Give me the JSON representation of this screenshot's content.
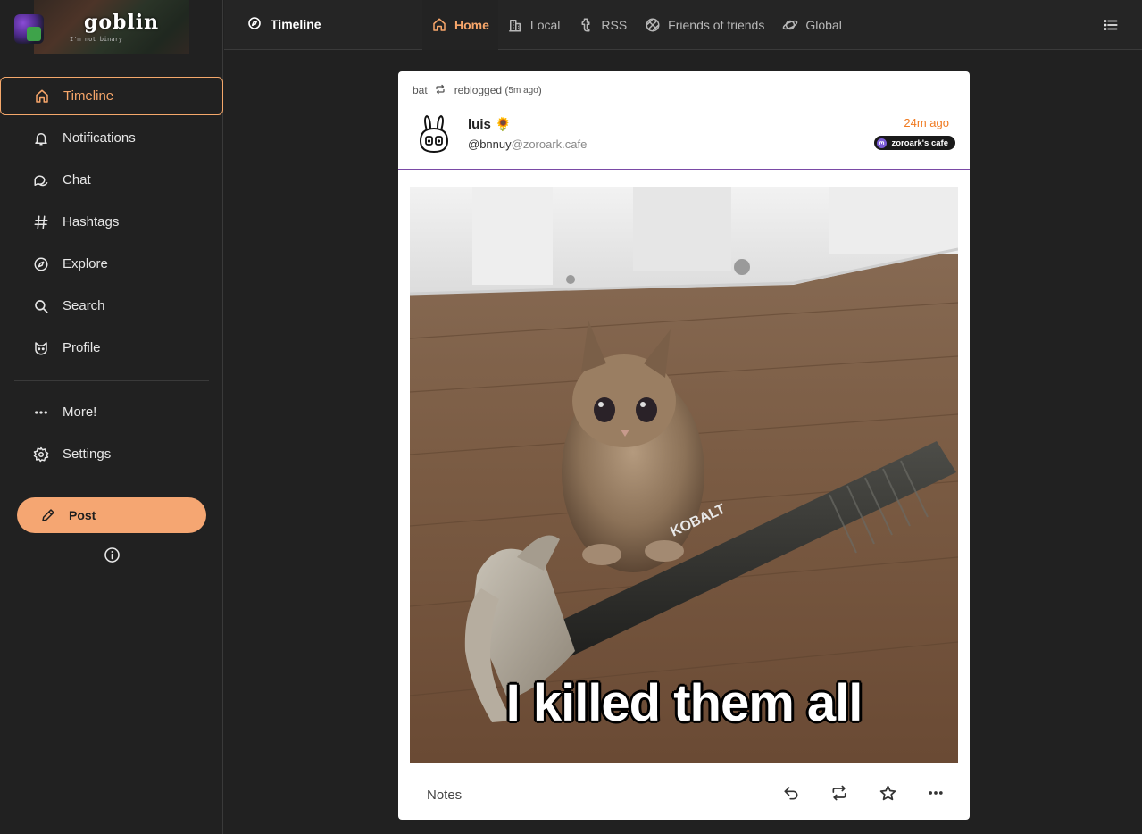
{
  "brand": {
    "name": "goblin",
    "tagline": "I'm not binary"
  },
  "sidebar": {
    "items": [
      {
        "label": "Timeline",
        "icon": "home-icon",
        "active": true
      },
      {
        "label": "Notifications",
        "icon": "bell-icon"
      },
      {
        "label": "Chat",
        "icon": "chat-icon"
      },
      {
        "label": "Hashtags",
        "icon": "hashtag-icon"
      },
      {
        "label": "Explore",
        "icon": "compass-icon"
      },
      {
        "label": "Search",
        "icon": "search-icon"
      },
      {
        "label": "Profile",
        "icon": "cat-face-icon"
      }
    ],
    "secondary": [
      {
        "label": "More!",
        "icon": "dots-icon"
      },
      {
        "label": "Settings",
        "icon": "gear-icon"
      }
    ],
    "post_label": "Post"
  },
  "topbar": {
    "title": "Timeline",
    "tabs": [
      {
        "label": "Home",
        "icon": "home-icon",
        "active": true
      },
      {
        "label": "Local",
        "icon": "building-icon"
      },
      {
        "label": "RSS",
        "icon": "rss-icon"
      },
      {
        "label": "Friends of friends",
        "icon": "basketball-icon"
      },
      {
        "label": "Global",
        "icon": "planet-icon"
      }
    ]
  },
  "post": {
    "reblogger": "bat",
    "reblog_text": "reblogged (",
    "reblog_time": "5m ago",
    "reblog_close": ")",
    "display_name": "luis 🌻",
    "handle_user": "@bnnuy",
    "handle_instance": "@zoroark.cafe",
    "time": "24m ago",
    "instance_badge": "zoroark's cafe",
    "image_caption": "I killed them all",
    "hammer_brand": "KOBALT",
    "notes_label": "Notes"
  },
  "colors": {
    "accent": "#f5a672",
    "active_text": "#f7a66a",
    "background": "#212121",
    "time_orange": "#f07a20",
    "divider_purple": "#7a4aa6"
  }
}
